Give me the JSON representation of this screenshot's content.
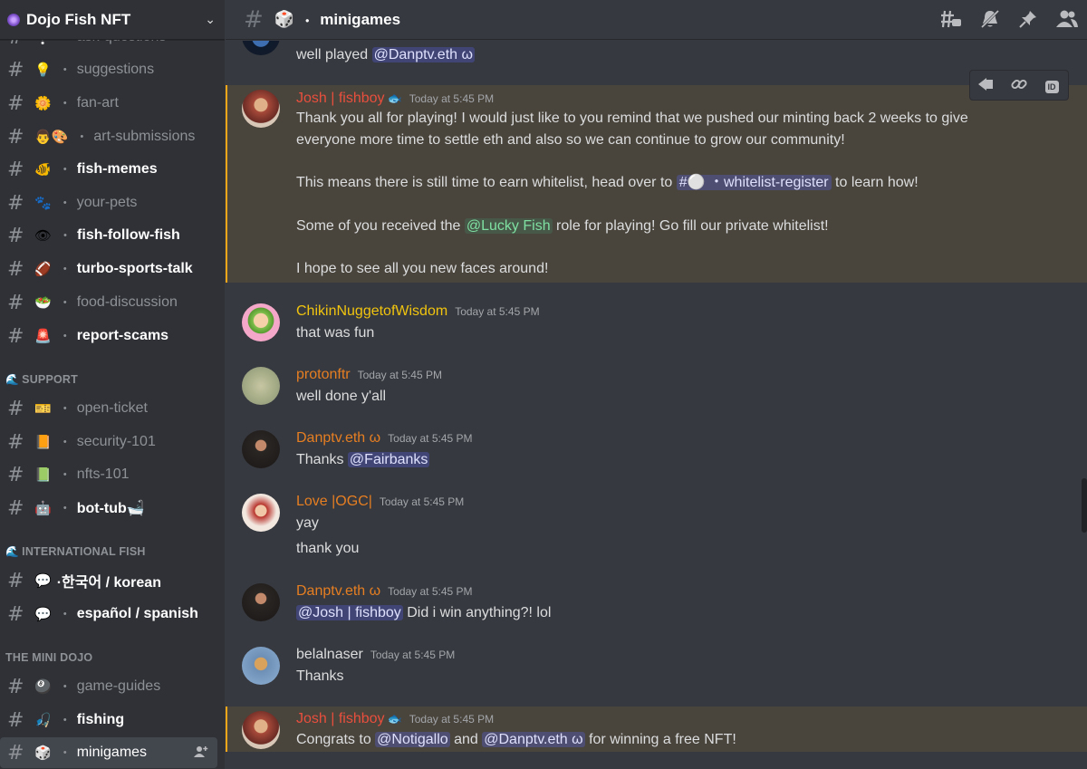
{
  "server": {
    "name": "Dojo Fish NFT"
  },
  "sidebar": {
    "channels": [
      {
        "emoji": "❔",
        "name": "ask-questions"
      },
      {
        "emoji": "💡",
        "name": "suggestions"
      },
      {
        "emoji": "🌼",
        "name": "fan-art"
      },
      {
        "emoji": "👨🎨",
        "name": "art-submissions"
      },
      {
        "emoji": "🐠",
        "name": "fish-memes"
      },
      {
        "emoji": "🐾",
        "name": "your-pets"
      },
      {
        "emoji": "👁",
        "name": "fish-follow-fish"
      },
      {
        "emoji": "🏈",
        "name": "turbo-sports-talk"
      },
      {
        "emoji": "🥗",
        "name": "food-discussion"
      },
      {
        "emoji": "🚨",
        "name": "report-scams"
      }
    ],
    "support": {
      "title": "SUPPORT",
      "channels": [
        {
          "emoji": "🎫",
          "name": "open-ticket"
        },
        {
          "emoji": "📙",
          "name": "security-101"
        },
        {
          "emoji": "📗",
          "name": "nfts-101"
        },
        {
          "emoji": "🤖",
          "name": "bot-tub🛁"
        }
      ]
    },
    "international": {
      "title": "INTERNATIONAL FISH",
      "channels": [
        {
          "emoji": "💬",
          "name": "·한국어 / korean"
        },
        {
          "emoji": "💬",
          "name": "español / spanish"
        }
      ]
    },
    "minidojo": {
      "title": "THE MINI DOJO",
      "channels": [
        {
          "emoji": "🎱",
          "name": "game-guides"
        },
        {
          "emoji": "🎣",
          "name": "fishing"
        },
        {
          "emoji": "🎲",
          "name": "minigames"
        }
      ]
    }
  },
  "topbar": {
    "emoji": "🎲",
    "channel": "minigames"
  },
  "messages": {
    "m0": {
      "line1_text": "well played ",
      "mention": "@Danptv.eth ω"
    },
    "m1": {
      "author": "Josh | fishboy",
      "author_suffix": "🐟",
      "timestamp": "Today at 5:45 PM",
      "l1": "Thank you all for playing! I would just like to you remind that we pushed our minting back 2 weeks to give",
      "l2": "everyone more time to settle eth and also so we can continue to grow our community!",
      "l3a": "This means there is still time to earn whitelist, head over to ",
      "l3ch": "#⚪ ・whitelist-register",
      "l3b": " to learn how!",
      "l4a": "Some of you received the ",
      "l4role": "@Lucky Fish",
      "l4b": " role for playing! Go fill our private whitelist!",
      "l5": "I hope to see all you new faces around!"
    },
    "m2": {
      "author": "ChikinNuggetofWisdom",
      "timestamp": "Today at 5:45 PM",
      "text": "that was fun"
    },
    "m3": {
      "author": "protonftr",
      "timestamp": "Today at 5:45 PM",
      "text": "well done y'all"
    },
    "m4": {
      "author": "Danptv.eth ω",
      "timestamp": "Today at 5:45 PM",
      "text": "Thanks ",
      "mention": "@Fairbanks"
    },
    "m5": {
      "author": "Love |OGC|",
      "timestamp": "Today at 5:45 PM",
      "l1": "yay",
      "l2": "thank you"
    },
    "m6": {
      "author": "Danptv.eth ω",
      "timestamp": "Today at 5:45 PM",
      "mention": "@Josh | fishboy",
      "text": " Did i win anything?! lol"
    },
    "m7": {
      "author": "belalnaser",
      "timestamp": "Today at 5:45 PM",
      "text": "Thanks"
    },
    "m8": {
      "author": "Josh | fishboy",
      "author_suffix": "🐟",
      "timestamp": "Today at 5:45 PM",
      "a": "Congrats to ",
      "mention1": "@Notigallo",
      "b": " and ",
      "mention2": "@Danptv.eth ω",
      "c": " for winning a free NFT!"
    }
  },
  "colors": {
    "sidebar_bg": "#2f3136",
    "chat_bg": "#36393f",
    "highlight_bg": "#49443c",
    "highlight_bar": "#faa81a",
    "josh": "#e94f3d",
    "orange": "#e67e22",
    "chikin": "#f1c40f",
    "belal": "#dcddde"
  },
  "icons": [
    "threads-icon",
    "mute-icon",
    "pin-icon",
    "members-icon",
    "hashtag-icon",
    "chevron-down-icon",
    "add-user-icon"
  ]
}
